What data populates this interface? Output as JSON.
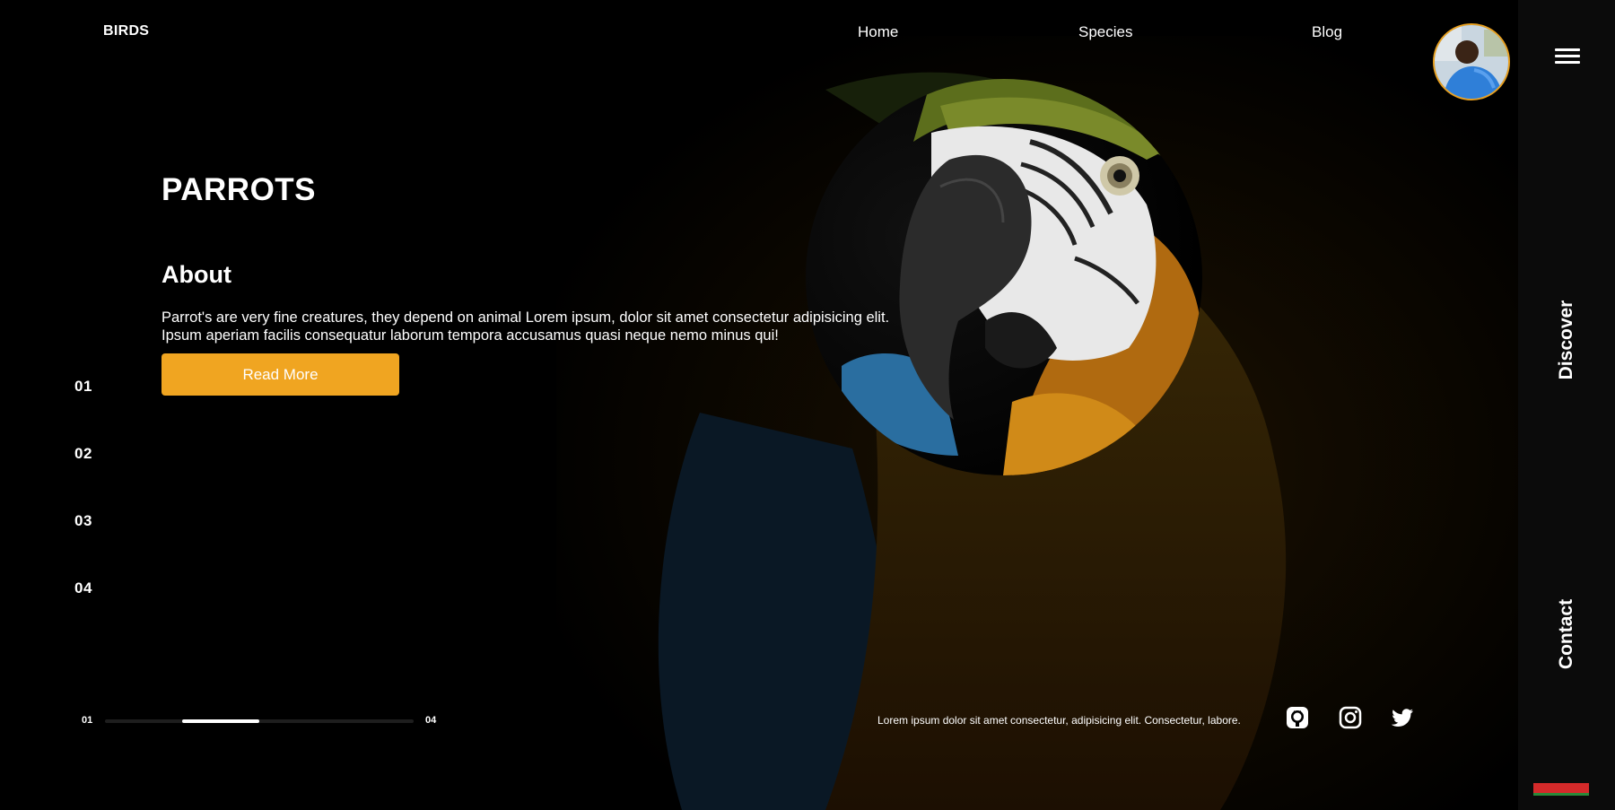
{
  "header": {
    "brand": "BIRDS",
    "nav": [
      "Home",
      "Species",
      "Blog"
    ]
  },
  "hero": {
    "title": "PARROTS",
    "about_title": "About",
    "about_text_line1": "Parrot's are very fine creatures, they depend on animal Lorem ipsum, dolor sit amet consectetur adipisicing elit.",
    "about_text_line2": "Ipsum aperiam facilis consequatur laborum tempora accusamus quasi neque nemo minus qui!",
    "button_label": "Read More"
  },
  "slides": [
    "01",
    "02",
    "03",
    "04"
  ],
  "progress": {
    "start_label": "01",
    "end_label": "04",
    "current_slide": 2,
    "total_slides": 4
  },
  "footer": {
    "text": "Lorem ipsum dolor sit amet consectetur, adipisicing elit. Consectetur, labore.",
    "social_icons": [
      "github-icon",
      "instagram-icon",
      "twitter-icon"
    ]
  },
  "side": {
    "discover": "Discover",
    "contact": "Contact"
  },
  "colors": {
    "accent": "#f0a521",
    "background": "#000000",
    "side_panel": "#0b0b0b"
  }
}
